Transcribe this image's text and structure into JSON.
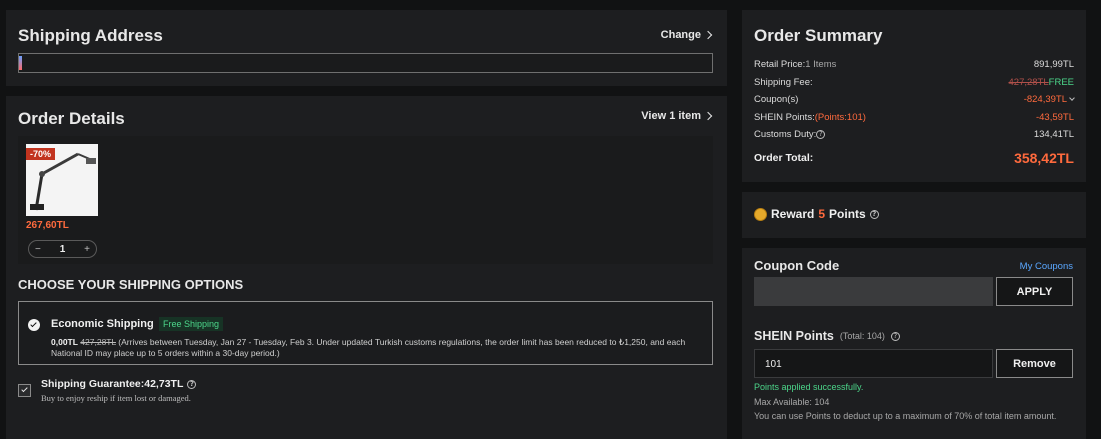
{
  "shipping_address": {
    "title": "Shipping Address",
    "change_label": "Change"
  },
  "order_details": {
    "title": "Order Details",
    "view_label": "View 1 item",
    "item": {
      "discount_badge": "-70%",
      "price": "267,60TL",
      "quantity": "1",
      "minus": "−",
      "plus": "+"
    }
  },
  "shipping_options": {
    "title": "CHOOSE YOUR SHIPPING OPTIONS",
    "method_name": "Economic Shipping",
    "method_badge": "Free Shipping",
    "price_now": "0,00TL",
    "price_old": "427,28TL",
    "note": " (Arrives between Tuesday, Jan 27 - Tuesday, Feb 3. Under updated Turkish customs regulations, the order limit has been reduced to ₺1,250, and each National ID may place up to 5 orders within a 30-day period.)",
    "guarantee_label": "Shipping Guarantee:42,73TL",
    "guarantee_sub": "Buy to enjoy reship if item lost or damaged."
  },
  "summary": {
    "title": "Order Summary",
    "retail_label": "Retail Price:",
    "retail_count": "1 Items",
    "retail_value": "891,99TL",
    "shipping_label": "Shipping Fee:",
    "shipping_old": "427,28TL",
    "shipping_value": "FREE",
    "coupon_label": "Coupon(s)",
    "coupon_value": "-824,39TL",
    "points_label": "SHEIN Points:",
    "points_detail": "(Points:101)",
    "points_value": "-43,59TL",
    "duty_label": "Customs Duty:",
    "duty_value": "134,41TL",
    "total_label": "Order Total:",
    "total_value": "358,42TL"
  },
  "reward": {
    "prefix": "Reward",
    "points": "5",
    "suffix": "Points"
  },
  "coupon": {
    "title": "Coupon Code",
    "my_coupons": "My Coupons",
    "input_value": "",
    "apply_label": "APPLY",
    "points_title": "SHEIN Points",
    "points_total": "(Total: 104)",
    "points_input": "101",
    "remove_label": "Remove",
    "success_msg": "Points applied successfully.",
    "max_available": "Max Available: 104",
    "points_note": "You can use Points to deduct up to a maximum of 70% of total item amount."
  },
  "icons": {
    "help": "help-circle-icon",
    "check": "checkmark-icon",
    "coin": "coin-icon"
  },
  "colors": {
    "accent": "#ff6a3d",
    "success": "#4cd68a",
    "link": "#5aa7ff"
  }
}
